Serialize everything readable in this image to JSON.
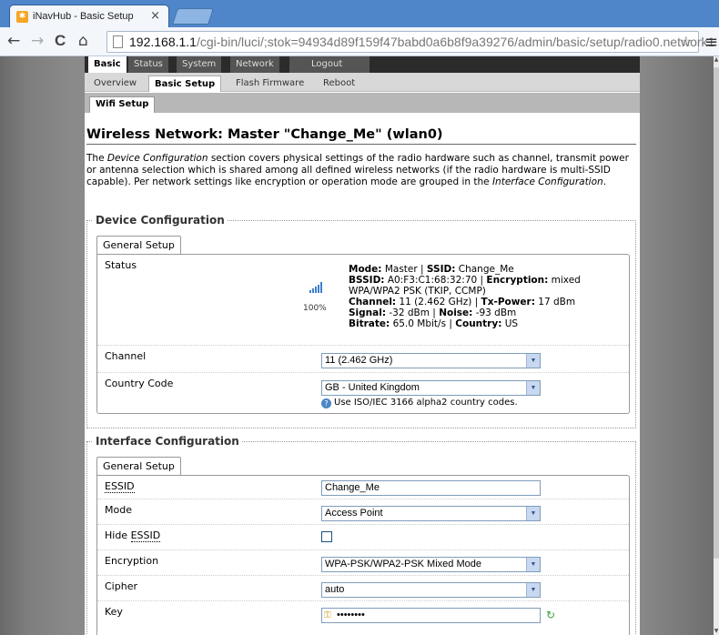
{
  "browser": {
    "tab_title": "iNavHub - Basic Setup",
    "tab_close": "×",
    "url_host": "192.168.1.1",
    "url_path": "/cgi-bin/luci/;stok=94934d89f159f47babd0a6b8f9a39276/admin/basic/setup/radio0.network1",
    "back": "←",
    "forward": "→",
    "reload": "C",
    "home": "⌂",
    "star": "☆",
    "menu": "≡"
  },
  "topmenu": [
    "Basic",
    "Status",
    "System",
    "Network",
    "Logout"
  ],
  "submenu": [
    "Overview",
    "Basic Setup",
    "Flash Firmware",
    "Reboot"
  ],
  "subsubmenu": "Wifi Setup",
  "page": {
    "title": "Wireless Network: Master \"Change_Me\" (wlan0)",
    "desc_1": "The ",
    "desc_em1": "Device Configuration",
    "desc_2": " section covers physical settings of the radio hardware such as channel, transmit power or antenna selection which is shared among all defined wireless networks (if the radio hardware is multi-SSID capable). Per network settings like encryption or operation mode are grouped in the ",
    "desc_em2": "Interface Configuration",
    "desc_3": "."
  },
  "device": {
    "legend": "Device Configuration",
    "tab": "General Setup",
    "status_label": "Status",
    "signal_percent": "100%",
    "status": {
      "mode_k": "Mode:",
      "mode_v": " Master | ",
      "ssid_k": "SSID:",
      "ssid_v": " Change_Me",
      "bssid_k": "BSSID:",
      "bssid_v": " A0:F3:C1:68:32:70 | ",
      "enc_k": "Encryption:",
      "enc_v": " mixed WPA/WPA2 PSK (TKIP, CCMP)",
      "chan_k": "Channel:",
      "chan_v": " 11 (2.462 GHz) | ",
      "tx_k": "Tx-Power:",
      "tx_v": " 17 dBm",
      "sig_k": "Signal:",
      "sig_v": " -32 dBm | ",
      "noise_k": "Noise:",
      "noise_v": " -93 dBm",
      "rate_k": "Bitrate:",
      "rate_v": " 65.0 Mbit/s | ",
      "country_k": "Country:",
      "country_v": " US"
    },
    "channel_label": "Channel",
    "channel_value": "11 (2.462 GHz)",
    "country_label": "Country Code",
    "country_value": "GB - United Kingdom",
    "country_hint": "Use ISO/IEC 3166 alpha2 country codes."
  },
  "iface": {
    "legend": "Interface Configuration",
    "tab": "General Setup",
    "essid_label": "ESSID",
    "essid_value": "Change_Me",
    "mode_label": "Mode",
    "mode_value": "Access Point",
    "hide_label_pre": "Hide ",
    "hide_label_abbr": "ESSID",
    "encryption_label": "Encryption",
    "encryption_value": "WPA-PSK/WPA2-PSK Mixed Mode",
    "cipher_label": "Cipher",
    "cipher_value": "auto",
    "key_label": "Key",
    "key_value": "••••••••"
  },
  "icons": {
    "favicon": "gear-icon",
    "select_arrow": "▼",
    "help": "?",
    "key": "🔑",
    "reveal": "↻"
  },
  "colors": {
    "chrome": "#4f86c9",
    "topmenu": "#2b2b2b",
    "select_border": "#7f9db9"
  }
}
